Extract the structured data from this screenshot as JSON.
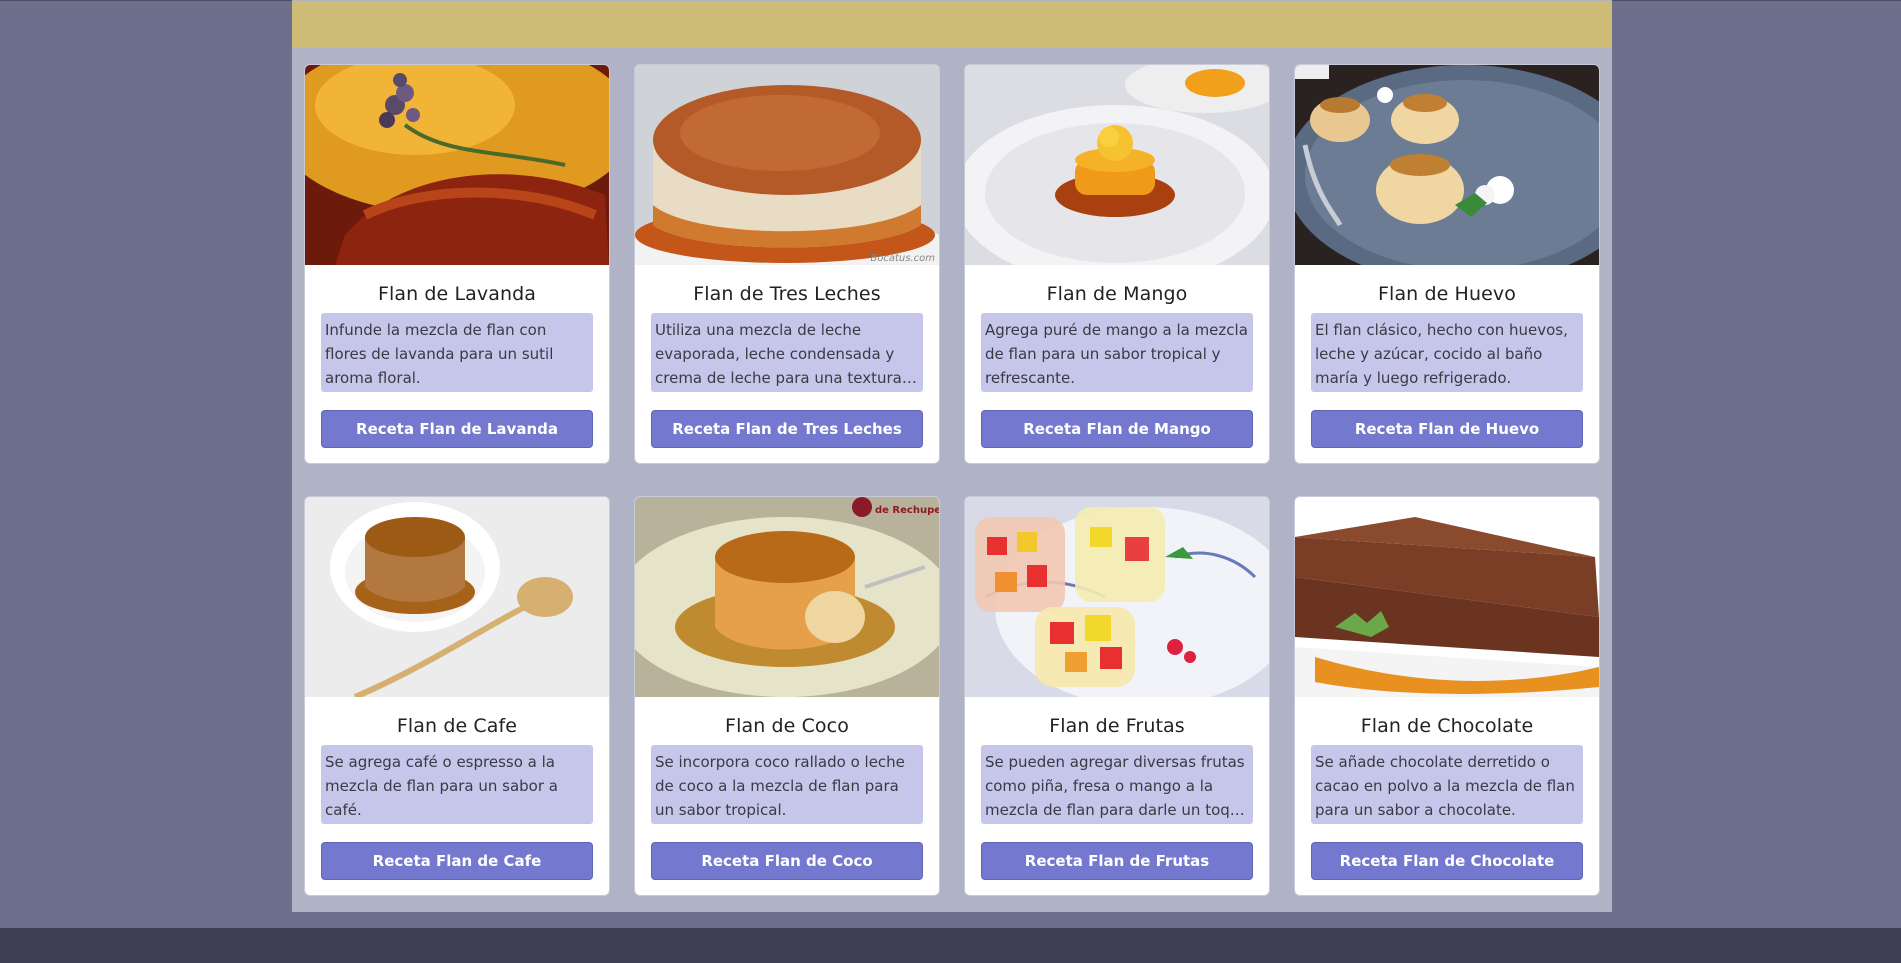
{
  "cards": [
    {
      "title": "Flan de Lavanda",
      "description": "Infunde la mezcla de flan con flores de lavanda para un sutil aroma floral.",
      "button": "Receta Flan de Lavanda",
      "image": "lavender-flan-photo"
    },
    {
      "title": "Flan de Tres Leches",
      "description": "Utiliza una mezcla de leche evaporada, leche condensada y crema de leche para una textura ultra cremosa.",
      "button": "Receta Flan de Tres Leches",
      "image": "tres-leches-flan-photo",
      "watermark": "Bocatus.com"
    },
    {
      "title": "Flan de Mango",
      "description": "Agrega puré de mango a la mezcla de flan para un sabor tropical y refrescante.",
      "button": "Receta Flan de Mango",
      "image": "mango-flan-photo"
    },
    {
      "title": "Flan de Huevo",
      "description": "El flan clásico, hecho con huevos, leche y azúcar, cocido al baño maría y luego refrigerado.",
      "button": "Receta Flan de Huevo",
      "image": "egg-flan-photo"
    },
    {
      "title": "Flan de Cafe",
      "description": "Se agrega café o espresso a la mezcla de flan para un sabor a café.",
      "button": "Receta Flan de Cafe",
      "image": "coffee-flan-photo"
    },
    {
      "title": "Flan de Coco",
      "description": "Se incorpora coco rallado o leche de coco a la mezcla de flan para un sabor tropical.",
      "button": "Receta Flan de Coco",
      "image": "coconut-flan-photo",
      "watermark": "de Rechupete"
    },
    {
      "title": "Flan de Frutas",
      "description": "Se pueden agregar diversas frutas como piña, fresa o mango a la mezcla de flan para darle un toque frutal.",
      "button": "Receta Flan de Frutas",
      "image": "fruit-flan-photo"
    },
    {
      "title": "Flan de Chocolate",
      "description": "Se añade chocolate derretido o cacao en polvo a la mezcla de flan para un sabor a chocolate.",
      "button": "Receta Flan de Chocolate",
      "image": "chocolate-flan-photo"
    }
  ],
  "colors": {
    "page_bg": "#6e6f8c",
    "header": "#cdbc75",
    "container": "#b0b2c5",
    "desc_bg": "#c5c6ea",
    "button": "#7479cf",
    "footer": "#3d3e51"
  }
}
